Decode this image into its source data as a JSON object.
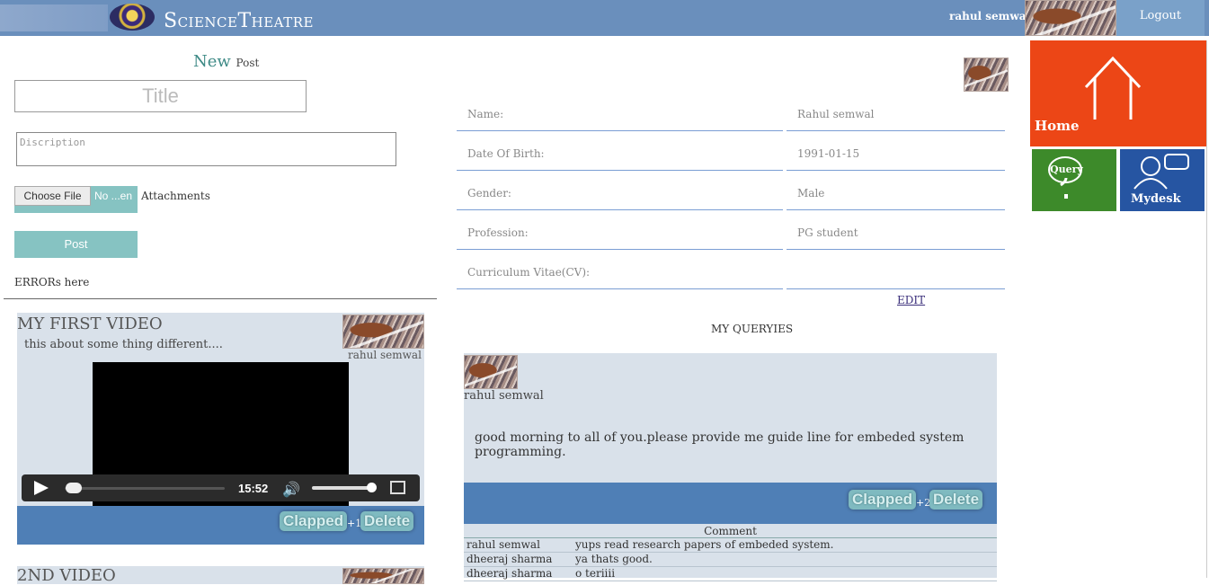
{
  "header": {
    "brand": "ScienceTheatre",
    "user": "rahul semwal",
    "logout_label": "Logout"
  },
  "new_post": {
    "heading_main": "New",
    "heading_sub": "Post",
    "title_placeholder": "Title",
    "description_placeholder": "Discription",
    "choose_file_label": "Choose File",
    "no_file_label": "No ...en",
    "attachments_label": "Attachments",
    "post_label": "Post",
    "errors_text": "ERRORs here"
  },
  "videos": [
    {
      "title": "MY FIRST VIDEO",
      "description": "this about some thing different....",
      "author": "rahul semwal",
      "duration": "15:52",
      "clapped_label": "Clapped",
      "clap_count": "+1",
      "delete_label": "Delete"
    },
    {
      "title": "2ND VIDEO"
    }
  ],
  "profile": {
    "rows": [
      {
        "label": "Name:",
        "value": "Rahul semwal"
      },
      {
        "label": "Date Of Birth:",
        "value": "1991-01-15"
      },
      {
        "label": "Gender:",
        "value": "Male"
      },
      {
        "label": "Profession:",
        "value": "PG student"
      },
      {
        "label": "Curriculum Vitae(CV):",
        "value": ""
      }
    ],
    "edit_label": "EDIT"
  },
  "queries": {
    "heading": "MY QUERYIES",
    "items": [
      {
        "author": "rahul semwal",
        "text": "good morning to all of you.please provide me guide line for embeded system programming.",
        "clapped_label": "Clapped",
        "clap_count": "+2",
        "delete_label": "Delete",
        "comment_heading": "Comment",
        "comments": [
          {
            "author": "rahul semwal",
            "text": "yups read research papers of embeded system."
          },
          {
            "author": "dheeraj sharma",
            "text": "ya thats good."
          },
          {
            "author": "dheeraj sharma",
            "text": "o teriiii"
          }
        ]
      }
    ]
  },
  "tiles": {
    "home": "Home",
    "query": "Query",
    "mydesk": "Mydesk",
    "colors": {
      "home": "#ec4616",
      "query": "#3d8a2a",
      "mydesk": "#2655a2"
    }
  }
}
